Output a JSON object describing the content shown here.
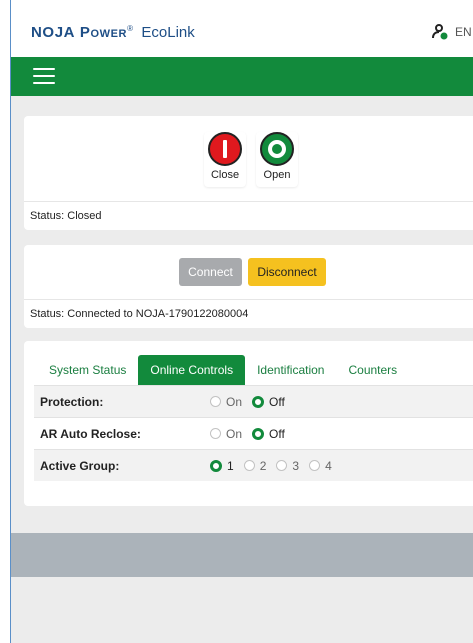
{
  "header": {
    "brand_noja": "NOJA",
    "brand_power": "Power",
    "brand_reg": "®",
    "brand_product": "EcoLink",
    "user_language": "EN",
    "user_icon": "user-status-icon"
  },
  "nav": {
    "menu_icon": "hamburger-icon"
  },
  "switch_panel": {
    "close_label": "Close",
    "open_label": "Open",
    "status": "Status: Closed",
    "close_color": "#e0191e",
    "open_color": "#128a3c"
  },
  "connection_panel": {
    "connect_label": "Connect",
    "disconnect_label": "Disconnect",
    "status": "Status: Connected to NOJA-1790122080004"
  },
  "tabs": [
    {
      "label": "System Status",
      "active": false
    },
    {
      "label": "Online Controls",
      "active": true
    },
    {
      "label": "Identification",
      "active": false
    },
    {
      "label": "Counters",
      "active": false
    }
  ],
  "controls": [
    {
      "label": "Protection:",
      "options": [
        "On",
        "Off"
      ],
      "selected": "Off"
    },
    {
      "label": "AR Auto Reclose:",
      "options": [
        "On",
        "Off"
      ],
      "selected": "Off"
    },
    {
      "label": "Active Group:",
      "options": [
        "1",
        "2",
        "3",
        "4"
      ],
      "selected": "1"
    }
  ],
  "colors": {
    "accent": "#128a3c",
    "brand": "#1e4e86",
    "warning": "#f5c11f"
  }
}
